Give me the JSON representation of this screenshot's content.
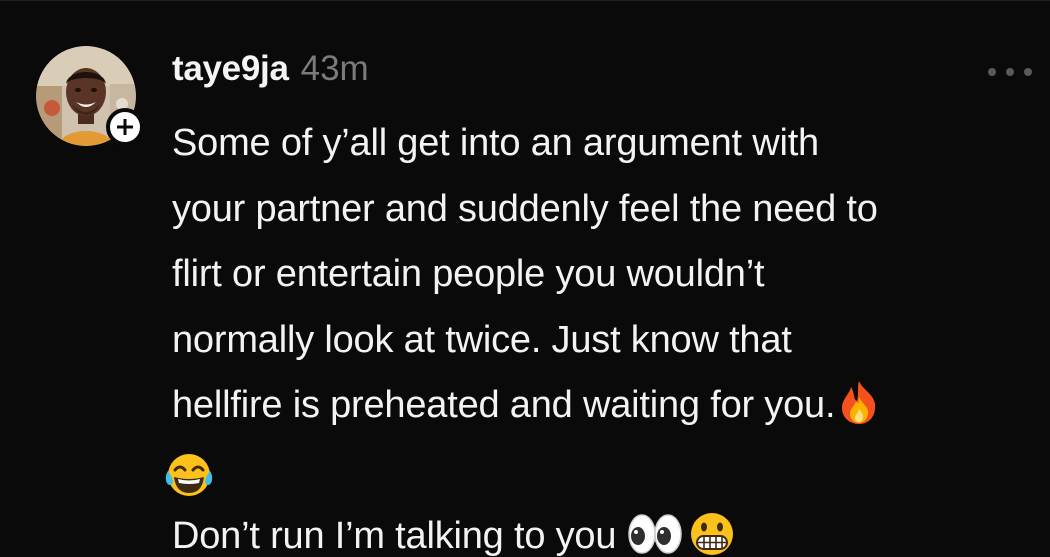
{
  "post": {
    "author": {
      "username": "taye9ja",
      "timestamp": "43m",
      "avatar_icon": "profile-photo",
      "follow_icon": "plus-icon"
    },
    "more_icon": "more-horizontal-icon",
    "body": {
      "lines": [
        "Some of y’all get into an argument with",
        "your partner and suddenly feel the need to",
        "flirt or entertain people you wouldn’t",
        "normally look at twice. Just know that",
        "hellfire is preheated and waiting for you."
      ],
      "final_line": "Don’t run I’m talking to you",
      "emojis": [
        "fire-emoji",
        "tears-of-joy-emoji",
        "eyes-emoji",
        "grimacing-emoji"
      ]
    },
    "colors": {
      "background": "#0a0a0a",
      "text": "#f3f3f3",
      "muted": "#7b7b7b"
    }
  }
}
